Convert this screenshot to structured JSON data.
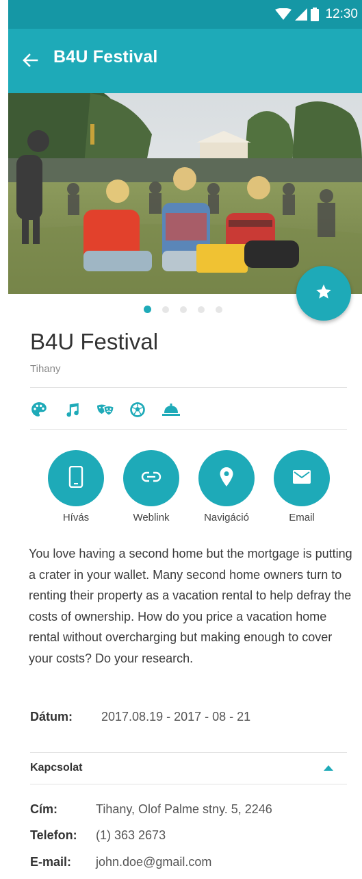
{
  "status_bar": {
    "time": "12:30"
  },
  "app_bar": {
    "title": "B4U Festival"
  },
  "carousel": {
    "slide_count": 5,
    "active_index": 0
  },
  "event": {
    "title": "B4U Festival",
    "location": "Tihany"
  },
  "categories": [
    "palette-icon",
    "music-note-icon",
    "theater-masks-icon",
    "soccer-ball-icon",
    "service-bell-icon"
  ],
  "actions": [
    {
      "label": "Hívás",
      "icon": "phone-icon"
    },
    {
      "label": "Weblink",
      "icon": "link-icon"
    },
    {
      "label": "Navigáció",
      "icon": "location-pin-icon"
    },
    {
      "label": "Email",
      "icon": "envelope-icon"
    }
  ],
  "description": "You love having a second home but the mortgage is putting a crater in your wallet. Many second home owners turn to renting their property as a vacation rental to help defray the costs of ownership. How do you price a vacation home rental without overcharging but making enough to cover your costs? Do your research.",
  "date": {
    "label": "Dátum:",
    "value": "2017.08.19 - 2017 - 08 - 21"
  },
  "contact": {
    "title": "Kapcsolat",
    "rows": [
      {
        "label": "Cím:",
        "value": "Tihany, Olof Palme stny. 5, 2246"
      },
      {
        "label": "Telefon:",
        "value": "(1) 363 2673"
      },
      {
        "label": "E-mail:",
        "value": "john.doe@gmail.com"
      }
    ]
  },
  "colors": {
    "accent": "#1eaab8",
    "status_bar": "#1597a5"
  }
}
